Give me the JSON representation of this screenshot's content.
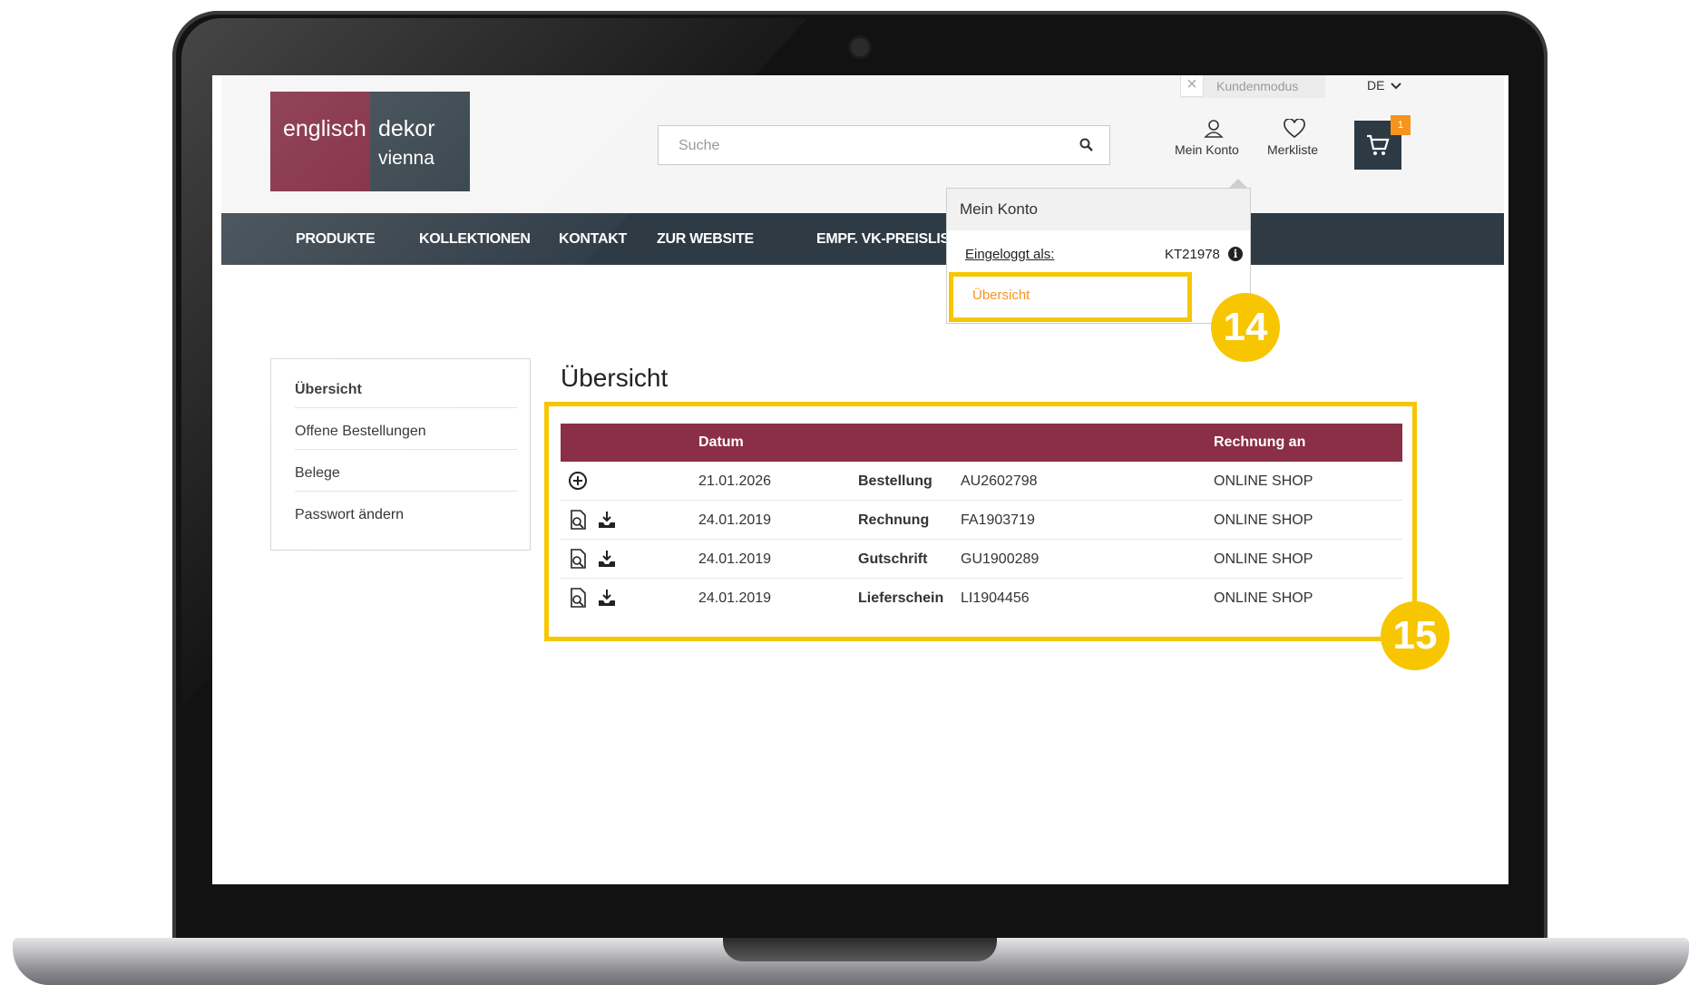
{
  "header": {
    "logo": {
      "word1": "englisch",
      "word2": "dekor",
      "word3": "vienna",
      "color_left": "#7b1e37",
      "color_right": "#2d3a43"
    },
    "kundenmodus": {
      "icon": "close-icon",
      "label": "Kundenmodus"
    },
    "language": "DE",
    "search": {
      "placeholder": "Suche",
      "value": ""
    },
    "account_label": "Mein Konto",
    "wishlist_label": "Merkliste",
    "cart_count": "1",
    "accent": "#f7941d"
  },
  "nav": {
    "items": [
      "PRODUKTE",
      "KOLLEKTIONEN",
      "KONTAKT",
      "ZUR WEBSITE",
      "EMPF. VK-PREISLISTE"
    ]
  },
  "account_dropdown": {
    "title": "Mein Konto",
    "logged_in_label": "Eingeloggt als:",
    "customer_id": "KT21978",
    "overview_link": "Übersicht"
  },
  "sidebar": {
    "items": [
      "Übersicht",
      "Offene Bestellungen",
      "Belege",
      "Passwort ändern"
    ]
  },
  "main": {
    "title": "Übersicht",
    "table": {
      "columns": {
        "date": "Datum",
        "bill_to": "Rechnung an"
      },
      "rows": [
        {
          "icons": [
            "plus-circle-icon"
          ],
          "date": "21.01.2026",
          "type": "Bestellung",
          "number": "AU2602798",
          "bill_to": "ONLINE SHOP"
        },
        {
          "icons": [
            "view-document-icon",
            "download-icon"
          ],
          "date": "24.01.2019",
          "type": "Rechnung",
          "number": "FA1903719",
          "bill_to": "ONLINE SHOP"
        },
        {
          "icons": [
            "view-document-icon",
            "download-icon"
          ],
          "date": "24.01.2019",
          "type": "Gutschrift",
          "number": "GU1900289",
          "bill_to": "ONLINE SHOP"
        },
        {
          "icons": [
            "view-document-icon",
            "download-icon"
          ],
          "date": "24.01.2019",
          "type": "Lieferschein",
          "number": "LI1904456",
          "bill_to": "ONLINE SHOP"
        }
      ]
    }
  },
  "callouts": {
    "dropdown_step": "14",
    "table_step": "15",
    "color": "#f7c600"
  }
}
